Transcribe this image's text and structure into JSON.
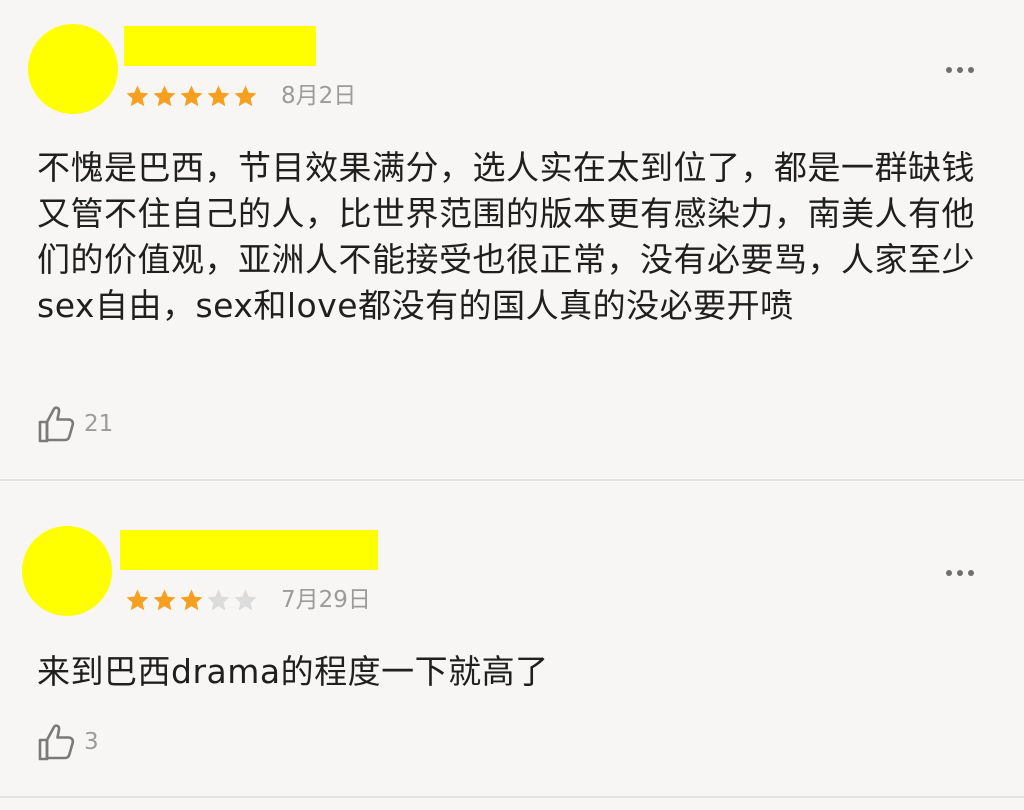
{
  "colors": {
    "page_background": "#f7f6f4",
    "redaction_yellow": "#ffff00",
    "star_filled": "#f5a021",
    "star_empty": "#dcdcdc",
    "meta_gray": "#9b9b9b",
    "divider": "#e6e4e1"
  },
  "icons": {
    "star": "star-icon",
    "more": "more-dots-icon",
    "like": "thumbs-up-icon"
  },
  "reviews": [
    {
      "rating": 5,
      "rating_max": 5,
      "date": "8月2日",
      "text": "不愧是巴西，节目效果满分，选人实在太到位了，都是一群缺钱又管不住自己的人，比世界范围的版本更有感染力，南美人有他们的价值观，亚洲人不能接受也很正常，没有必要骂，人家至少sex自由，sex和love都没有的国人真的没必要开喷",
      "likes": "21"
    },
    {
      "rating": 3,
      "rating_max": 5,
      "date": "7月29日",
      "text": "来到巴西drama的程度一下就高了",
      "likes": "3"
    }
  ]
}
